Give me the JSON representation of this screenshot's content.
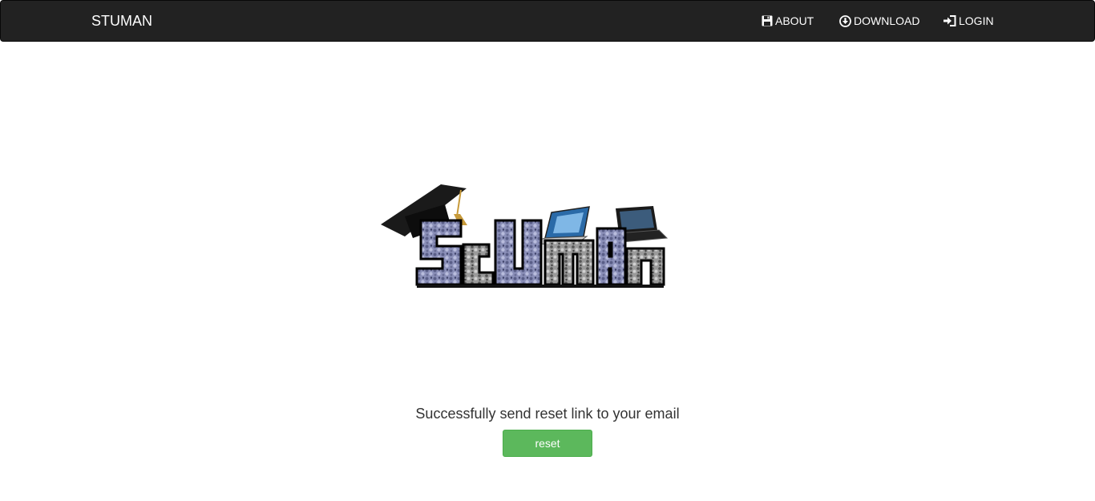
{
  "navbar": {
    "brand": "STUMAN",
    "items": [
      {
        "label": "ABOUT",
        "icon": "floppy-disk-icon"
      },
      {
        "label": "DOWNLOAD",
        "icon": "download-circle-icon"
      },
      {
        "label": "LOGIN",
        "icon": "login-icon"
      }
    ]
  },
  "logo": {
    "text": "STUMAN"
  },
  "main": {
    "message": "Successfully send reset link to your email",
    "reset_label": "reset"
  },
  "colors": {
    "navbar_bg": "#222222",
    "button_green": "#5cb85c",
    "text_dark": "#333333"
  }
}
